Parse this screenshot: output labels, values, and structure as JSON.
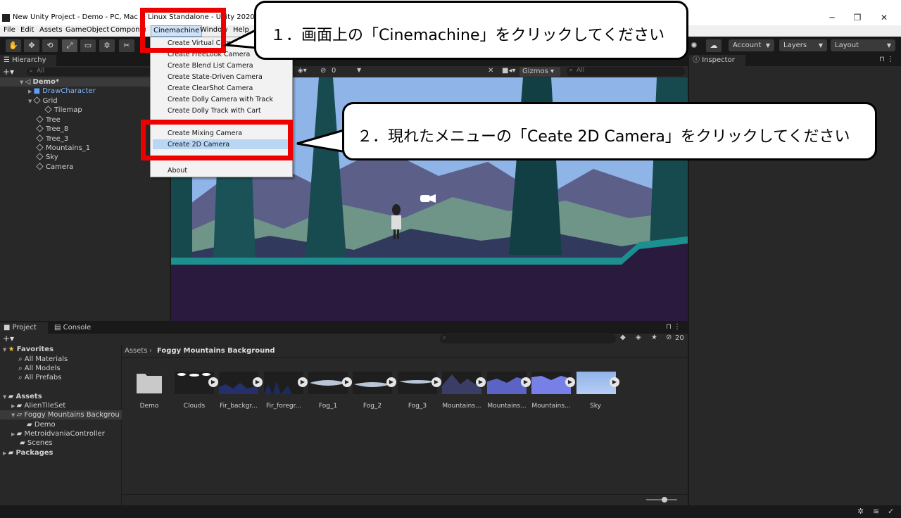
{
  "window": {
    "title": "New Unity Project - Demo - PC, Mac & Linux Standalone - Unity 2020.3.10f1 Pe",
    "controls": [
      "─",
      "❐",
      "✕"
    ]
  },
  "menubar": [
    "File",
    "Edit",
    "Assets",
    "GameObject",
    "Component",
    "Cinemachine",
    "Window",
    "Help"
  ],
  "toolbar": {
    "account": "Account",
    "layers": "Layers",
    "layout": "Layout"
  },
  "hierarchy": {
    "tab": "Hierarchy",
    "search_placeholder": "All",
    "scene": "Demo*",
    "items": [
      "DrawCharacter",
      "Grid",
      "Tilemap",
      "Tree",
      "Tree_8",
      "Tree_3",
      "Mountains_1",
      "Sky",
      "Camera"
    ]
  },
  "scene_toolbar": {
    "hidden_count": "0",
    "gizmos": "Gizmos",
    "search_placeholder": "All"
  },
  "inspector": {
    "tab": "Inspector"
  },
  "cinemachine_menu": {
    "items": [
      "Create Virtual Camera",
      "Create FreeLook Camera",
      "Create Blend List Camera",
      "Create State-Driven Camera",
      "Create ClearShot Camera",
      "Create Dolly Camera with Track",
      "Create Dolly Track with Cart",
      "Create Mixing Camera",
      "Create 2D Camera",
      "About"
    ],
    "highlighted": "Create 2D Camera"
  },
  "callouts": {
    "step1": "１．画面上の「Cinemachine」をクリックしてください",
    "step2": "２．現れたメニューの「Ceate 2D Camera」をクリックしてください"
  },
  "project": {
    "tabs": [
      "Project",
      "Console"
    ],
    "breadcrumb": [
      "Assets",
      "Foggy Mountains Background"
    ],
    "hidden_count": "20",
    "favorites": {
      "label": "Favorites",
      "items": [
        "All Materials",
        "All Models",
        "All Prefabs"
      ]
    },
    "assets_tree": {
      "label": "Assets",
      "items": [
        "AlienTileSet",
        "Foggy Mountains Backgrou",
        "Demo",
        "MetroidvaniaController",
        "Scenes"
      ]
    },
    "packages": "Packages",
    "assets": [
      "Demo",
      "Clouds",
      "Fir_backgr...",
      "Fir_foregr...",
      "Fog_1",
      "Fog_2",
      "Fog_3",
      "Mountains...",
      "Mountains...",
      "Mountains...",
      "Sky"
    ]
  },
  "colors": {
    "highlight_box": "#ee0000",
    "menu_highlight": "#b9d7f5",
    "selection_blue": "#2c5d87",
    "sky": "#8fb4e8"
  }
}
